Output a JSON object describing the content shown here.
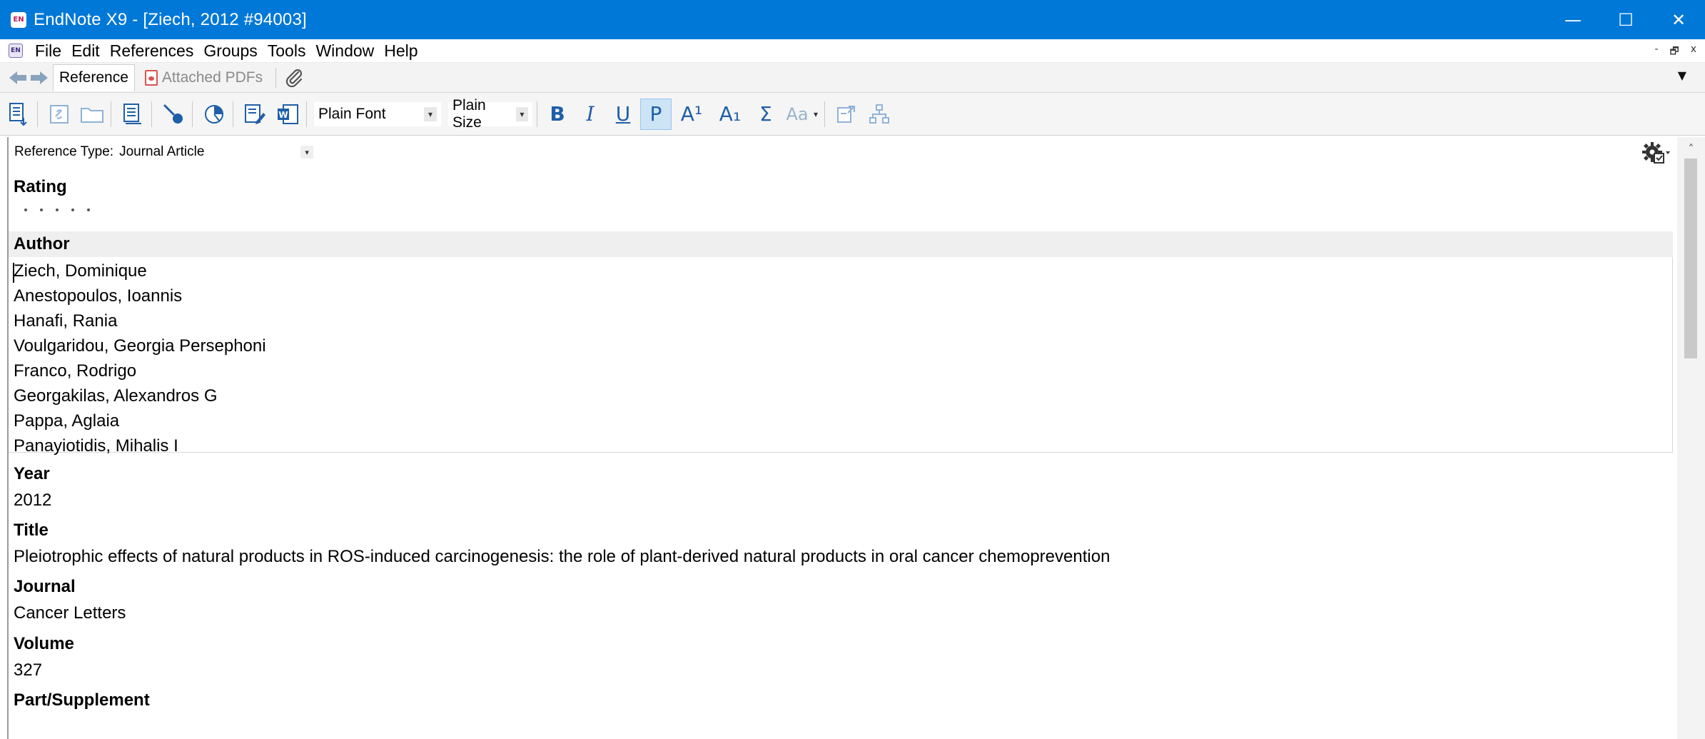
{
  "window": {
    "title": "EndNote X9 - [Ziech, 2012 #94003]",
    "app_icon_text": "EN",
    "minimize": "—",
    "maximize": "☐",
    "close": "✕"
  },
  "menubar": {
    "icon_text": "EN",
    "items": [
      "File",
      "Edit",
      "References",
      "Groups",
      "Tools",
      "Window",
      "Help"
    ],
    "mdi_minimize": "-",
    "mdi_restore": "🗗",
    "mdi_close": "x"
  },
  "tabs": {
    "reference": "Reference",
    "attached_pdfs": "Attached PDFs",
    "dropdown": "▼"
  },
  "toolbar": {
    "font": "Plain Font",
    "size": "Plain Size",
    "bold": "B",
    "italic": "I",
    "underline": "U",
    "plain": "P",
    "superscript": "A¹",
    "subscript": "A₁",
    "symbol": "Σ",
    "case": "Aa"
  },
  "reference": {
    "type_label": "Reference Type:",
    "type_value": "Journal Article",
    "fields": {
      "rating_label": "Rating",
      "author_label": "Author",
      "authors": [
        "Ziech, Dominique",
        "Anestopoulos, Ioannis",
        "Hanafi, Rania",
        "Voulgaridou, Georgia Persephoni",
        "Franco, Rodrigo",
        "Georgakilas, Alexandros G",
        "Pappa, Aglaia",
        "Panayiotidis, Mihalis I"
      ],
      "year_label": "Year",
      "year": "2012",
      "title_label": "Title",
      "title": "Pleiotrophic effects of natural products in ROS-induced carcinogenesis: the role of plant-derived natural products in oral cancer chemoprevention",
      "journal_label": "Journal",
      "journal": "Cancer Letters",
      "volume_label": "Volume",
      "volume": "327",
      "part_label": "Part/Supplement"
    }
  },
  "colors": {
    "titlebar": "#0078d7",
    "icon_blue": "#1f5fa8",
    "active_format": "#cde4f7"
  }
}
